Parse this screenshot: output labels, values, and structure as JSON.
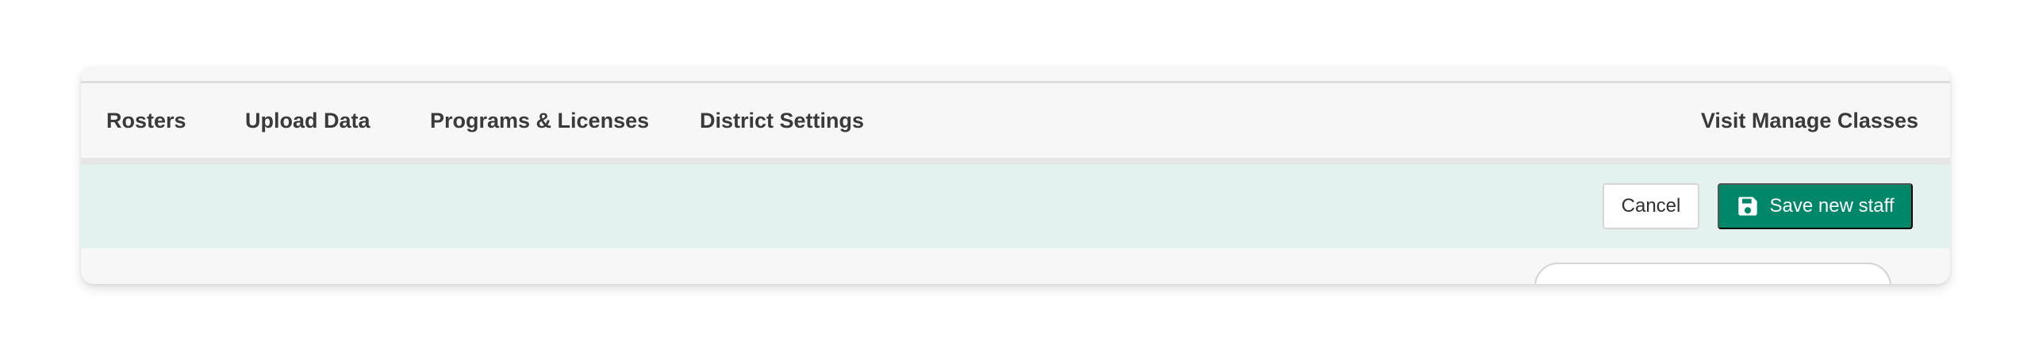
{
  "nav": {
    "items": [
      {
        "label": "Rosters"
      },
      {
        "label": "Upload Data"
      },
      {
        "label": "Programs & Licenses"
      },
      {
        "label": "District Settings"
      }
    ],
    "right_link": "Visit Manage Classes"
  },
  "actions": {
    "cancel_label": "Cancel",
    "save_label": "Save new staff",
    "save_icon": "floppy-disk-icon"
  },
  "colors": {
    "primary": "#00876a",
    "action_bar_bg": "#e3f2ef",
    "nav_bg": "#f7f7f7",
    "nav_text": "#3a3a3a"
  }
}
